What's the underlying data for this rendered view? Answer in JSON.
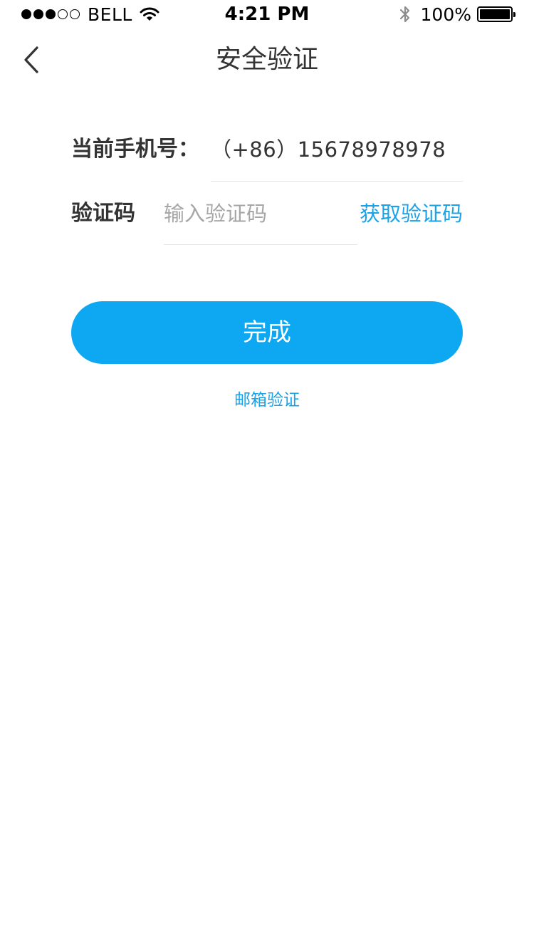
{
  "status_bar": {
    "signal_filled": 3,
    "signal_total": 5,
    "carrier": "BELL",
    "time": "4:21 PM",
    "battery_percent_text": "100%",
    "battery_level": 1.0,
    "icons": [
      "signal-dots",
      "wifi-icon",
      "bluetooth-icon",
      "battery-icon"
    ]
  },
  "nav": {
    "back_icon": "chevron-left-icon",
    "title": "安全验证"
  },
  "form": {
    "phone_label": "当前手机号：",
    "phone_value": "（+86）15678978978",
    "code_label": "验证码",
    "code_value": "",
    "code_placeholder": "输入验证码",
    "get_code_label": "获取验证码"
  },
  "actions": {
    "submit_label": "完成",
    "email_verify_label": "邮箱验证"
  },
  "colors": {
    "accent": "#1aa3e8",
    "button": "#0ea7f1",
    "text_primary": "#333333",
    "placeholder": "#a6a6a6",
    "divider": "#e6e6e6",
    "background": "#ffffff"
  }
}
